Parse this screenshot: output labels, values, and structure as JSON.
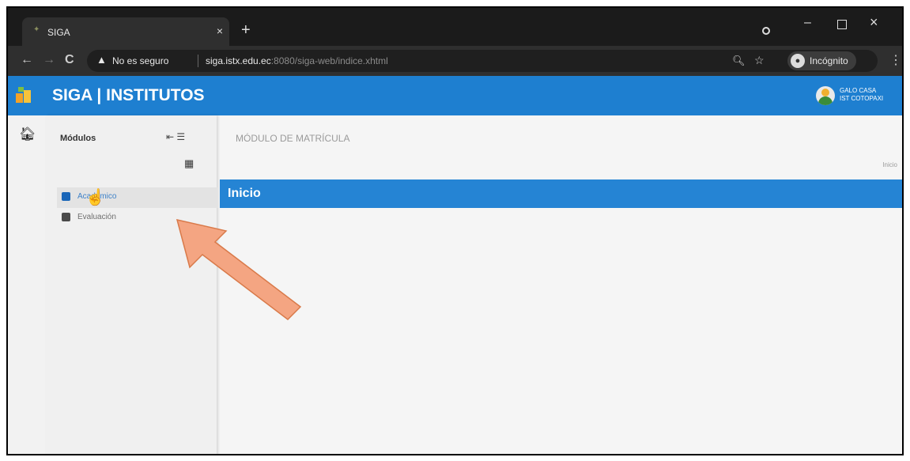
{
  "browser": {
    "tab_title": "SIGA",
    "tab_close": "×",
    "new_tab": "+",
    "security_text": "No es seguro",
    "url_host": "siga.istx.edu.ec",
    "url_rest": ":8080/siga-web/indice.xhtml",
    "incognito_label": "Incógnito",
    "icons": [
      "back-arrow-icon",
      "forward-arrow-icon",
      "reload-icon",
      "warning-icon",
      "zoom-icon",
      "star-icon",
      "incognito-icon",
      "menu-icon"
    ]
  },
  "app": {
    "title": "SIGA | INSTITUTOS",
    "user_line1": "GALO CASA",
    "user_line2": "IST COTOPAXI",
    "brand_color": "#1e7fd0"
  },
  "sidebar": {
    "modules_label": "Módulos",
    "items": [
      {
        "label": "Académico"
      },
      {
        "label": "Evaluación"
      }
    ]
  },
  "main": {
    "module_title": "MÓDULO DE MATRÍCULA",
    "breadcrumb": "Inicio",
    "banner_title": "Inicio",
    "accent": "#2584d4"
  },
  "annotation": {
    "arrow_color": "#f4a582"
  }
}
